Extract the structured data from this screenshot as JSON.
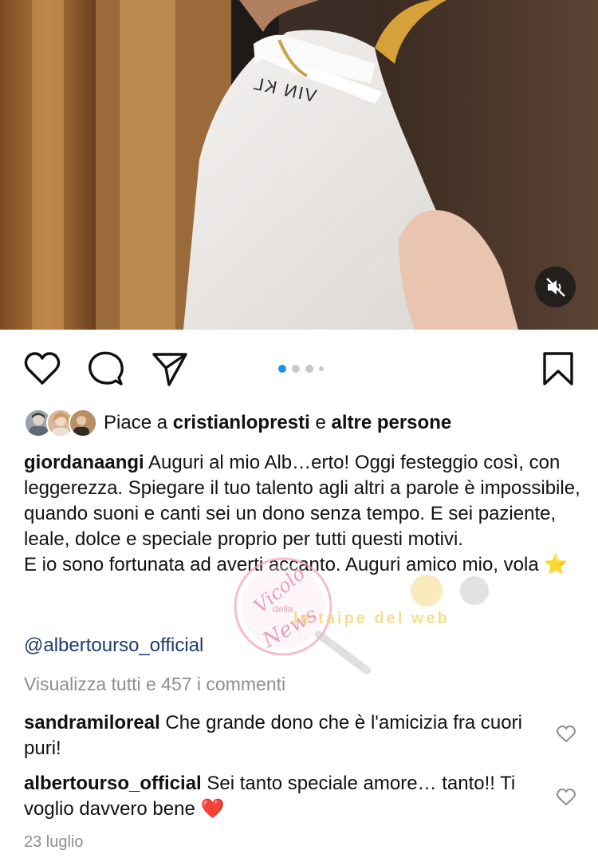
{
  "media": {
    "mute_icon": "speaker-muted-icon",
    "collar_text": "VIN KL"
  },
  "actions": {
    "like_icon": "heart-outline-icon",
    "comment_icon": "comment-bubble-icon",
    "share_icon": "paper-plane-icon",
    "save_icon": "bookmark-outline-icon",
    "carousel_dots": 4,
    "carousel_active_index": 0,
    "accent_color": "#1e8ff0"
  },
  "likes": {
    "prefix": "Piace a ",
    "user": "cristianlopresti",
    "middle": " e ",
    "others": "altre persone"
  },
  "caption": {
    "user": "giordanaangi",
    "text": " Auguri al mio Alb…erto! Oggi festeggio così, con leggerezza. Spiegare il tuo talento agli altri a parole è impossibile, quando suoni e canti sei un dono senza tempo. E sei paziente, leale, dolce e speciale proprio per tutti questi motivi.",
    "text2": "E io sono fortunata ad averti accanto. Auguri amico mio, vola ⭐",
    "mention": "@albertourso_official"
  },
  "view_comments": "Visualizza tutti e 457 i commenti",
  "comments": [
    {
      "user": "sandramiloreal",
      "text": " Che grande dono che è l'amicizia fra cuori puri!"
    },
    {
      "user": "albertourso_official",
      "text": " Sei tanto speciale amore… tanto!! Ti voglio davvero bene ❤️"
    }
  ],
  "date": "23 luglio",
  "watermark": {
    "logo_text_1": "Vicolo",
    "logo_text_2": "della",
    "logo_text_3": "News",
    "banner": "le taipe del web"
  }
}
